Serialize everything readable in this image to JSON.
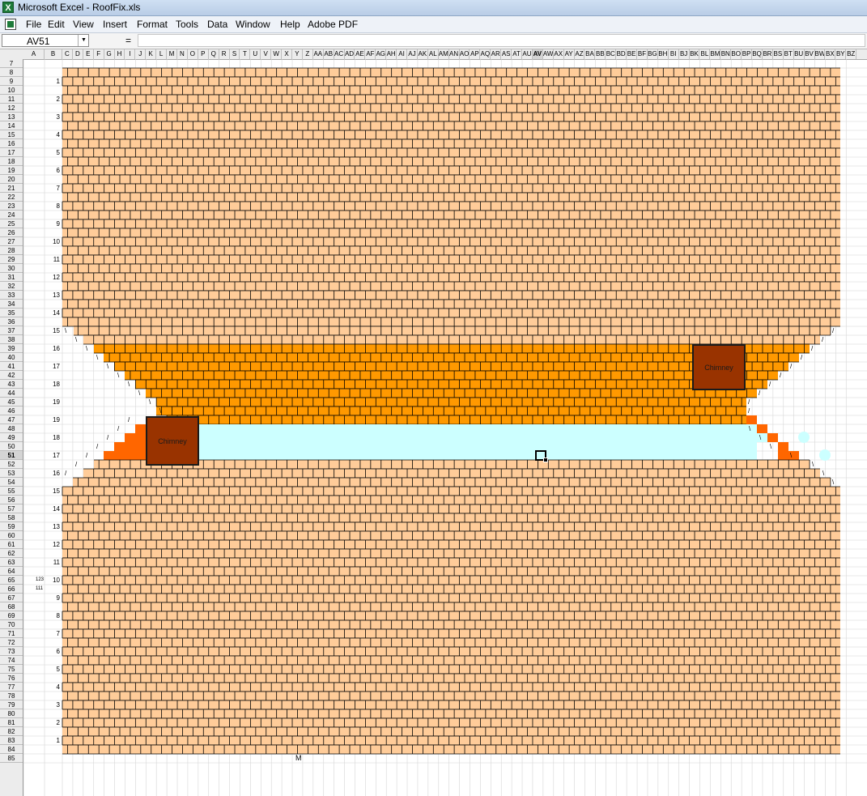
{
  "window": {
    "title": "Microsoft Excel - RoofFix.xls",
    "app_icon": "excel-icon"
  },
  "menu": {
    "items": [
      "File",
      "Edit",
      "View",
      "Insert",
      "Format",
      "Tools",
      "Data",
      "Window",
      "Help",
      "Adobe PDF"
    ]
  },
  "formula_bar": {
    "name_box": "AV51",
    "fx_symbol": "=",
    "formula": ""
  },
  "columns": [
    "A",
    "B",
    "C",
    "D",
    "E",
    "F",
    "G",
    "H",
    "I",
    "J",
    "K",
    "L",
    "M",
    "N",
    "O",
    "P",
    "Q",
    "R",
    "S",
    "T",
    "U",
    "V",
    "W",
    "X",
    "Y",
    "Z",
    "AA",
    "AB",
    "AC",
    "AD",
    "AE",
    "AF",
    "AG",
    "AH",
    "AI",
    "AJ",
    "AK",
    "AL",
    "AM",
    "AN",
    "AO",
    "AP",
    "AQ",
    "AR",
    "AS",
    "AT",
    "AU",
    "AV",
    "AW",
    "AX",
    "AY",
    "AZ",
    "BA",
    "BB",
    "BC",
    "BD",
    "BE",
    "BF",
    "BG",
    "BH",
    "BI",
    "BJ",
    "BK",
    "BL",
    "BM",
    "BN",
    "BO",
    "BP",
    "BQ",
    "BR",
    "BS",
    "BT",
    "BU",
    "BV",
    "BW",
    "BX",
    "BY",
    "BZ"
  ],
  "column_labels_shown": [
    "A",
    "B",
    "C",
    "D",
    "E",
    "F",
    "G",
    "H",
    "I",
    "J",
    "K",
    "L",
    "M",
    "N",
    "O",
    "P",
    "Q",
    "R",
    "S",
    "T",
    "U",
    "V",
    "W",
    "X",
    "Y",
    "Z",
    "AA",
    "AB",
    "AC",
    "AD",
    "AE",
    "AF",
    "AG",
    "AH",
    "AI",
    "AJ",
    "AK",
    "AL",
    "AM",
    "AN",
    "AO",
    "AP",
    "AQ",
    "AR",
    "AS",
    "AT",
    "AU",
    "AV",
    "AW",
    "AX",
    "AY",
    "AZ",
    "BA",
    "BB",
    "BC",
    "BD",
    "BE",
    "BF",
    "BG",
    "BH",
    "BI",
    "BJ",
    "BK",
    "BL",
    "BM",
    "BN",
    "BO",
    "BP",
    "BQ",
    "BR",
    "BS",
    "BT",
    "BU",
    "BV",
    "BW",
    "BX",
    "BY",
    "BZ"
  ],
  "selected": {
    "cell": "AV51",
    "row": 51,
    "column": "AV"
  },
  "rows": {
    "first": 7,
    "last": 85
  },
  "course_numbers_upper": [
    "1",
    "2",
    "3",
    "4",
    "5",
    "6",
    "7",
    "8",
    "9",
    "10",
    "11",
    "12",
    "13",
    "14",
    "15",
    "16",
    "17",
    "18",
    "19",
    "19"
  ],
  "course_numbers_lower": [
    "18",
    "17",
    "16",
    "15",
    "14",
    "13",
    "12",
    "11",
    "10",
    "9",
    "8",
    "7",
    "6",
    "5",
    "4",
    "3",
    "2",
    "1"
  ],
  "side_values": [
    "123",
    "111"
  ],
  "chimneys": [
    {
      "label": "Chimney"
    },
    {
      "label": "Chimney"
    }
  ],
  "slash_marks": [
    "\\",
    "/"
  ],
  "bottom_marker": "M",
  "colors": {
    "light_shingle": "#ffcc99",
    "dark_shingle": "#ff9900",
    "step_orange": "#ff6600",
    "sky": "#ccffff",
    "chimney": "#993300",
    "mortar": "#000000"
  }
}
